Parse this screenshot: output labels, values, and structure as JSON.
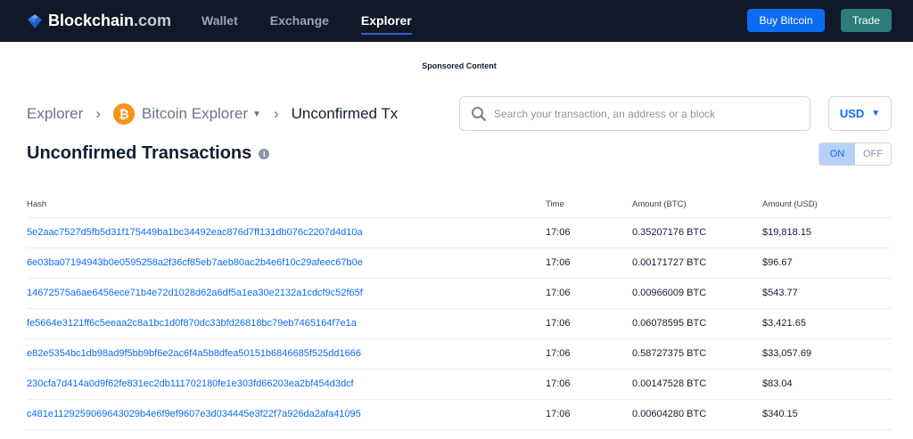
{
  "nav": {
    "brand": "Blockchain",
    "brand_suffix": ".com",
    "links": [
      "Wallet",
      "Exchange",
      "Explorer"
    ],
    "buy": "Buy Bitcoin",
    "trade": "Trade"
  },
  "sponsored": "Sponsored Content",
  "breadcrumb": {
    "root": "Explorer",
    "sep": "›",
    "coin": "Bitcoin Explorer",
    "current": "Unconfirmed Tx",
    "coin_symbol": "₿"
  },
  "search": {
    "placeholder": "Search your transaction, an address or a block"
  },
  "currency": "USD",
  "title": "Unconfirmed Transactions",
  "toggle": {
    "on": "ON",
    "off": "OFF"
  },
  "table": {
    "headers": [
      "Hash",
      "Time",
      "Amount (BTC)",
      "Amount (USD)"
    ],
    "rows": [
      [
        "5e2aac7527d5fb5d31f175449ba1bc34492eac876d7ff131db076c2207d4d10a",
        "17:06",
        "0.35207176 BTC",
        "$19,818.15"
      ],
      [
        "6e03ba07194943b0e0595258a2f36cf85eb7aeb80ac2b4e6f10c29afeec67b0e",
        "17:06",
        "0.00171727 BTC",
        "$96.67"
      ],
      [
        "14672575a6ae6456ece71b4e72d1028d62a6df5a1ea30e2132a1cdcf9c52f65f",
        "17:06",
        "0.00966009 BTC",
        "$543.77"
      ],
      [
        "fe5664e3121ff6c5eeaa2c8a1bc1d0f870dc33bfd26818bc79eb7465164f7e1a",
        "17:06",
        "0.06078595 BTC",
        "$3,421.65"
      ],
      [
        "e82e5354bc1db98ad9f5bb9bf6e2ac6f4a5b8dfea50151b6846685f525dd1666",
        "17:06",
        "0.58727375 BTC",
        "$33,057.69"
      ],
      [
        "230cfa7d414a0d9f62fe831ec2db111702180fe1e303fd66203ea2bf454d3dcf",
        "17:06",
        "0.00147528 BTC",
        "$83.04"
      ],
      [
        "c481e1129259069643029b4e6f9ef9607e3d034445e3f22f7a926da2afa41095",
        "17:06",
        "0.00604280 BTC",
        "$340.15"
      ]
    ]
  }
}
